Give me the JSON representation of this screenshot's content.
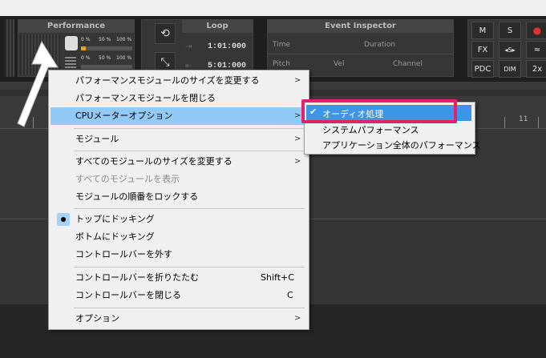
{
  "performance": {
    "title": "Performance",
    "cpu_labels": [
      "0 %",
      "50 %",
      "100 %"
    ],
    "cpu_level": 0.1
  },
  "loop": {
    "title": "Loop",
    "start": "1:01:000",
    "end": "5:01:000"
  },
  "event_inspector": {
    "title": "Event Inspector",
    "fields": [
      "Time",
      "Duration",
      "Pitch",
      "Vel",
      "Channel"
    ]
  },
  "right_buttons": {
    "m": "M",
    "s": "S",
    "fx": "FX",
    "pdc": "PDC",
    "dim": "DIM",
    "x2": "2x"
  },
  "ruler": {
    "marker": "11"
  },
  "context_menu": {
    "items": [
      {
        "label": "パフォーマンスモジュールのサイズを変更する",
        "submenu": true
      },
      {
        "label": "パフォーマンスモジュールを閉じる"
      },
      {
        "label": "CPUメーターオプション",
        "submenu": true,
        "highlighted": true
      },
      {
        "label": "モジュール",
        "submenu": true
      },
      {
        "label": "すべてのモジュールのサイズを変更する",
        "submenu": true
      },
      {
        "label": "すべてのモジュールを表示",
        "disabled": true
      },
      {
        "label": "モジュールの順番をロックする"
      },
      {
        "label": "トップにドッキング",
        "checked": true
      },
      {
        "label": "ボトムにドッキング"
      },
      {
        "label": "コントロールバーを外す"
      },
      {
        "label": "コントロールバーを折りたたむ",
        "shortcut": "Shift+C"
      },
      {
        "label": "コントロールバーを閉じる",
        "shortcut": "C"
      },
      {
        "label": "オプション",
        "submenu": true
      }
    ]
  },
  "submenu": {
    "items": [
      {
        "label": "オーディオ処理",
        "checked": true
      },
      {
        "label": "システムパフォーマンス"
      },
      {
        "label": "アプリケーション全体のパフォーマンス"
      }
    ]
  },
  "colors": {
    "menu_bg": "#f0f0f0",
    "menu_highlight": "#91c9f7",
    "submenu_highlight": "#3b95e8",
    "callout_border": "#e5206e",
    "cpu_fill": "#f0a020"
  }
}
